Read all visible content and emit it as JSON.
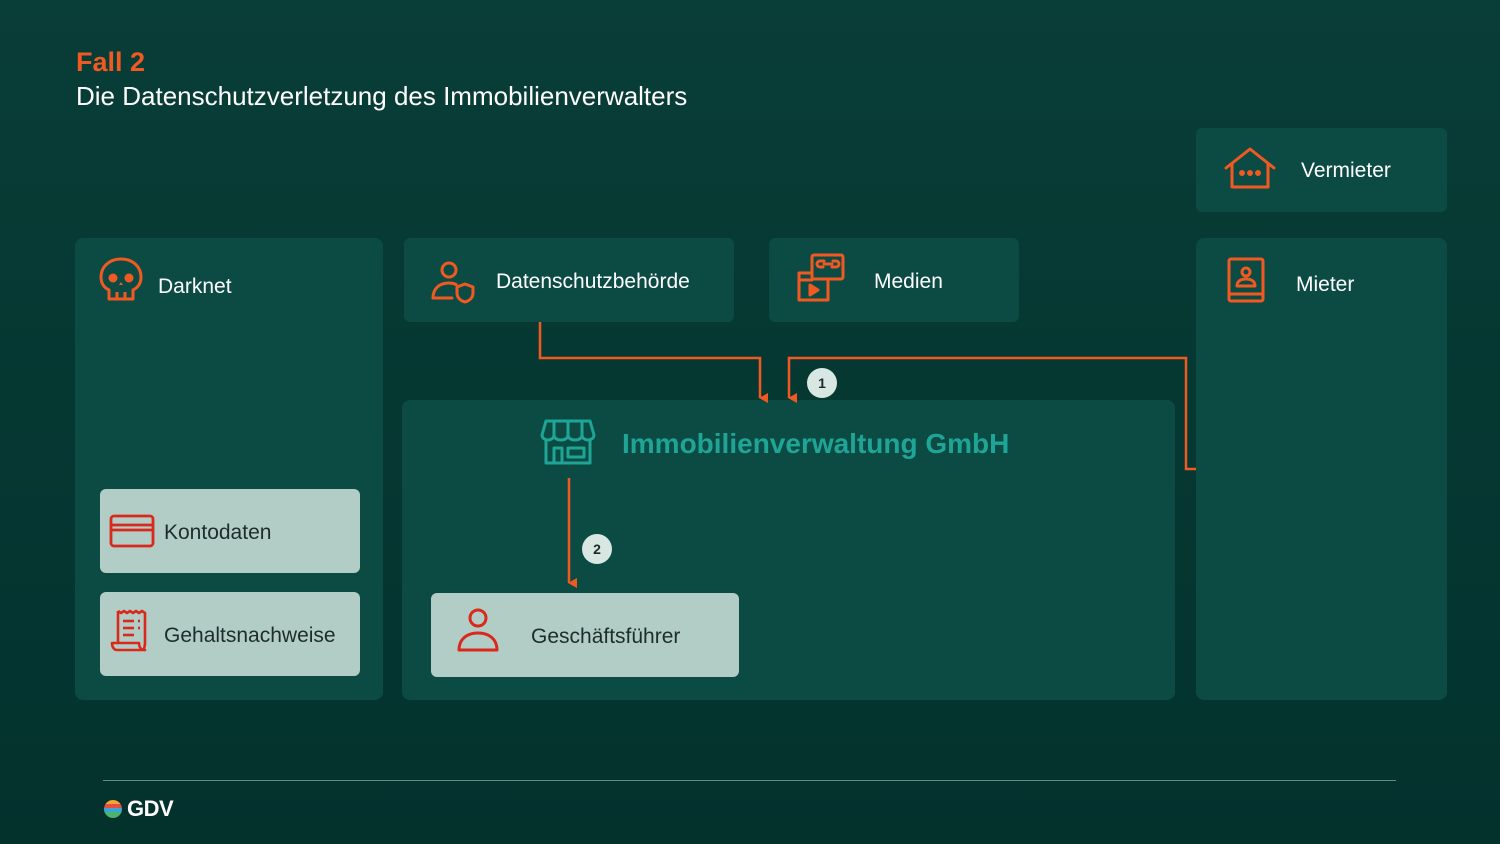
{
  "header": {
    "kicker": "Fall 2",
    "title": "Die Datenschutzverletzung des Immobilienverwalters"
  },
  "nodes": {
    "darknet": "Darknet",
    "authority": "Datenschutzbehörde",
    "media": "Medien",
    "landlord": "Vermieter",
    "tenant": "Mieter",
    "company": "Immobilienverwaltung GmbH",
    "ceo": "Geschäftsführer"
  },
  "darknet_items": [
    "Kontodaten",
    "Gehaltsnachweise"
  ],
  "steps": [
    "1",
    "2"
  ],
  "footer": {
    "logo": "GDV"
  },
  "colors": {
    "background": "#063a34",
    "panel": "#0c4a44",
    "accent_orange": "#f05a22",
    "card_bg": "#b2cdc5",
    "company_teal": "#1fa596",
    "icon_red": "#d9291c"
  },
  "icons": {
    "darknet": "skull-icon",
    "authority": "user-shield-icon",
    "media": "media-icon",
    "landlord": "house-icon",
    "tenant": "id-card-icon",
    "company": "storefront-icon",
    "ceo": "person-icon",
    "kontodaten": "credit-card-icon",
    "gehalt": "receipt-icon"
  }
}
